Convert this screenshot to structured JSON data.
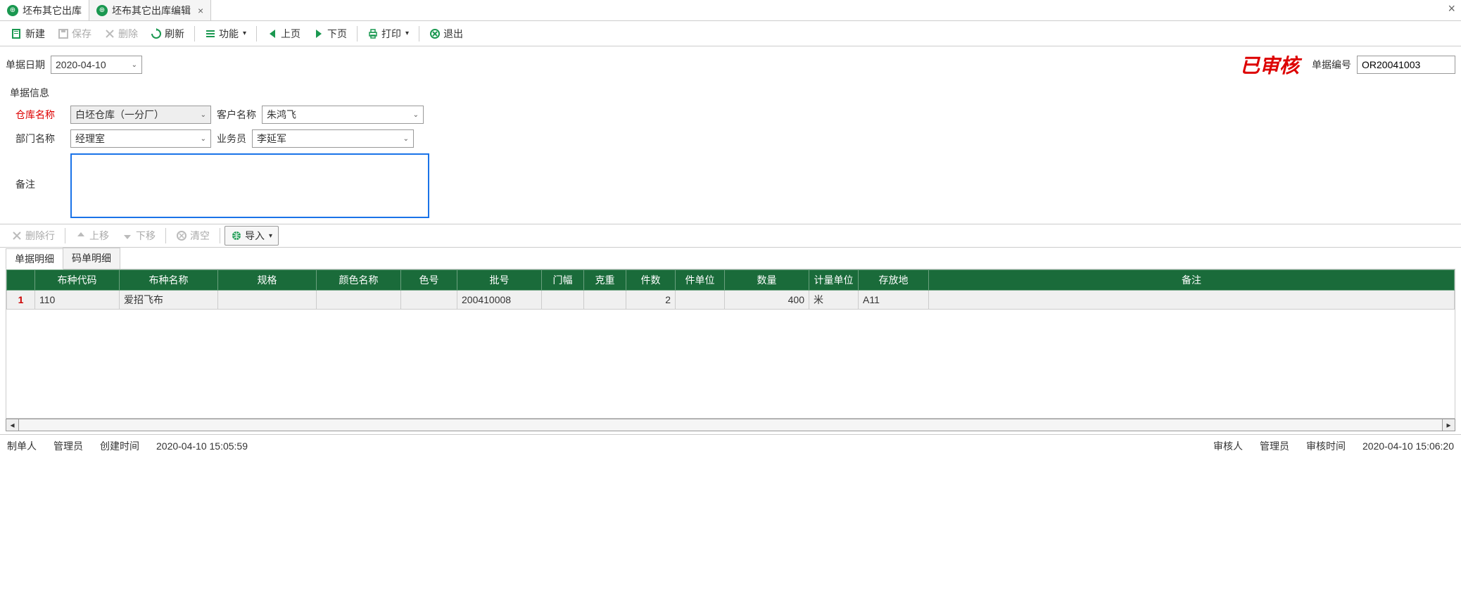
{
  "tabs": [
    {
      "label": "坯布其它出库",
      "closable": false,
      "active": false
    },
    {
      "label": "坯布其它出库编辑",
      "closable": true,
      "active": true
    }
  ],
  "toolbar": {
    "new": "新建",
    "save": "保存",
    "delete": "删除",
    "refresh": "刷新",
    "functions": "功能",
    "prev": "上页",
    "next": "下页",
    "print": "打印",
    "exit": "退出"
  },
  "header": {
    "date_label": "单据日期",
    "date_value": "2020-04-10",
    "approved_stamp": "已审核",
    "docno_label": "单据编号",
    "docno_value": "OR20041003"
  },
  "fieldset": {
    "title": "单据信息",
    "warehouse_label": "仓库名称",
    "warehouse_value": "白坯仓库（一分厂）",
    "customer_label": "客户名称",
    "customer_value": "朱鸿飞",
    "dept_label": "部门名称",
    "dept_value": "经理室",
    "sales_label": "业务员",
    "sales_value": "李延军",
    "remark_label": "备注",
    "remark_value": ""
  },
  "row_toolbar": {
    "delete_row": "删除行",
    "move_up": "上移",
    "move_down": "下移",
    "clear": "清空",
    "import": "导入"
  },
  "detail_tabs": [
    {
      "label": "单据明细",
      "active": true
    },
    {
      "label": "码单明细",
      "active": false
    }
  ],
  "grid": {
    "columns": [
      "",
      "布种代码",
      "布种名称",
      "规格",
      "颜色名称",
      "色号",
      "批号",
      "门幅",
      "克重",
      "件数",
      "件单位",
      "数量",
      "计量单位",
      "存放地",
      "备注"
    ],
    "rows": [
      {
        "rownum": "1",
        "code": "110",
        "name": "爱招飞布",
        "spec": "",
        "color_name": "",
        "color_no": "",
        "batch": "200410008",
        "width": "",
        "weight": "",
        "pieces": "2",
        "piece_unit": "",
        "qty": "400",
        "unit": "米",
        "location": "A11",
        "remark": ""
      }
    ]
  },
  "status": {
    "creator_label": "制单人",
    "creator_value": "管理员",
    "create_time_label": "创建时间",
    "create_time_value": "2020-04-10 15:05:59",
    "auditor_label": "审核人",
    "auditor_value": "管理员",
    "audit_time_label": "审核时间",
    "audit_time_value": "2020-04-10 15:06:20"
  }
}
